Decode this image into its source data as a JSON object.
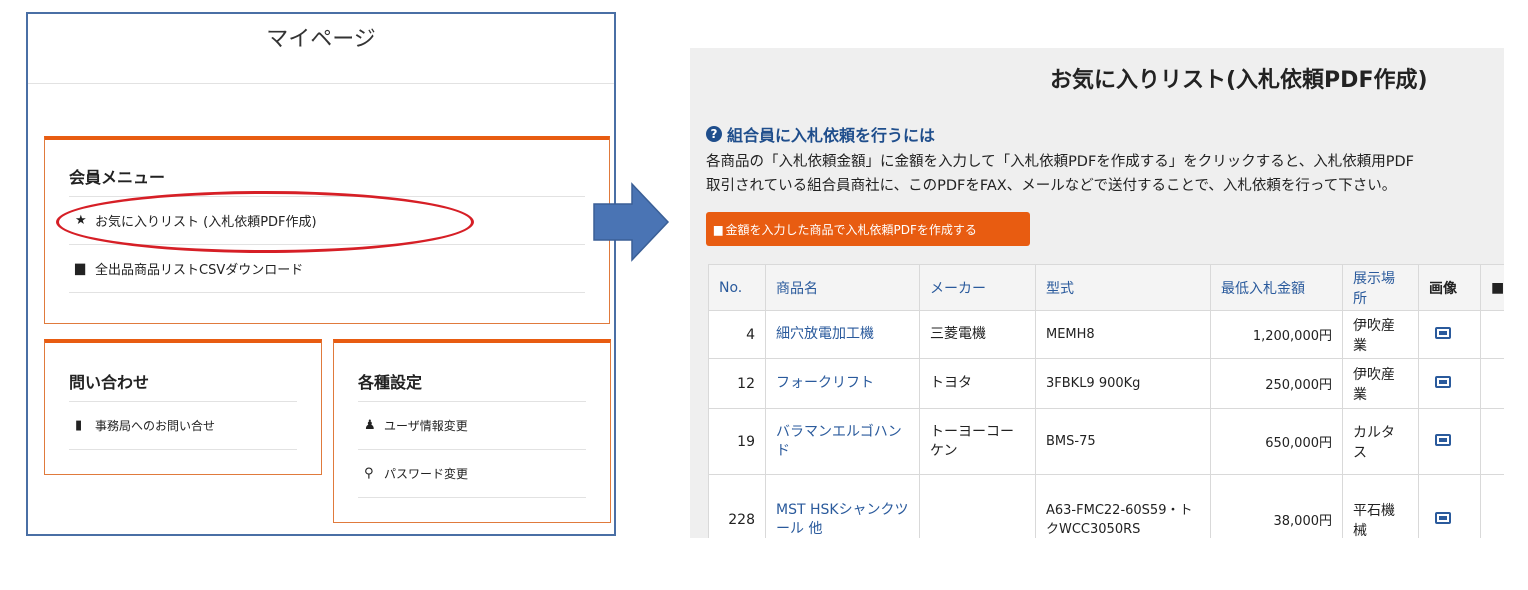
{
  "mypage": {
    "title": "マイページ",
    "member_menu": {
      "heading": "会員メニュー",
      "items": [
        {
          "icon": "star-icon",
          "label": "お気に入りリスト (入札依頼PDF作成)"
        },
        {
          "icon": "file-icon",
          "label": "全出品商品リストCSVダウンロード"
        }
      ]
    },
    "contact": {
      "heading": "問い合わせ",
      "items": [
        {
          "icon": "address-book-icon",
          "label": "事務局へのお問い合せ"
        }
      ]
    },
    "settings": {
      "heading": "各種設定",
      "items": [
        {
          "icon": "user-edit-icon",
          "label": "ユーザ情報変更"
        },
        {
          "icon": "key-icon",
          "label": "パスワード変更"
        }
      ]
    }
  },
  "favorites": {
    "title": "お気に入りリスト(入札依頼PDF作成)",
    "help_heading": "組合員に入札依頼を行うには",
    "help_line_1": "各商品の「入札依頼金額」に金額を入力して「入札依頼PDFを作成する」をクリックすると、入札依頼用PDF",
    "help_line_2": "取引されている組合員商社に、このPDFをFAX、メールなどで送付することで、入札依頼を行って下さい。",
    "create_button": "金額を入力した商品で入札依頼PDFを作成する",
    "table": {
      "headers": [
        "No.",
        "商品名",
        "メーカー",
        "型式",
        "最低入札金額",
        "展示場所",
        "画像",
        "■"
      ],
      "rows": [
        {
          "no": "4",
          "name": "細穴放電加工機",
          "maker": "三菱電機",
          "model": "MEMH8",
          "price": "1,200,000円",
          "place": "伊吹産業"
        },
        {
          "no": "12",
          "name": "フォークリフト",
          "maker": "トヨタ",
          "model": "3FBKL9 900Kg",
          "price": "250,000円",
          "place": "伊吹産業"
        },
        {
          "no": "19",
          "name": "バラマンエルゴハンド",
          "maker": "トーヨーコーケン",
          "model": "BMS-75",
          "price": "650,000円",
          "place": "カルタス"
        },
        {
          "no": "228",
          "name": "MST HSKシャンクツール 他",
          "maker": "",
          "model": "A63-FMC22-60S59・トクWCC3050RS",
          "price": "38,000円",
          "place": "平石機械"
        }
      ]
    }
  },
  "colors": {
    "accent_orange": "#e85c11",
    "link_blue": "#2a5a9c",
    "highlight_red": "#d61f26",
    "arrow_blue": "#4a74b4",
    "panel_border": "#4a6fa5"
  }
}
